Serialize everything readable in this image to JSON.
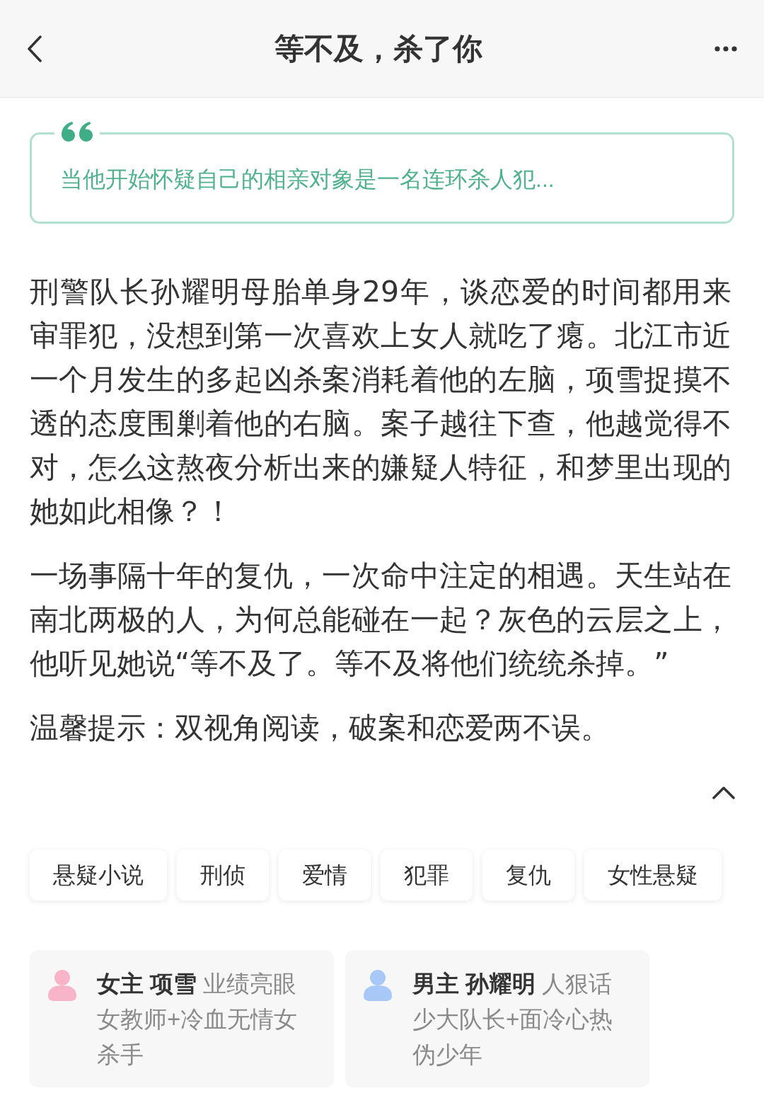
{
  "header": {
    "title": "等不及，杀了你"
  },
  "quote": {
    "text": "当他开始怀疑自己的相亲对象是一名连环杀人犯..."
  },
  "synopsis": {
    "paragraphs": [
      "刑警队长孙耀明母胎单身29年，谈恋爱的时间都用来审罪犯，没想到第一次喜欢上女人就吃了瘪。北江市近一个月发生的多起凶杀案消耗着他的左脑，项雪捉摸不透的态度围剿着他的右脑。案子越往下查，他越觉得不对，怎么这熬夜分析出来的嫌疑人特征，和梦里出现的她如此相像？！",
      "一场事隔十年的复仇，一次命中注定的相遇。天生站在南北两极的人，为何总能碰在一起？灰色的云层之上，他听见她说“等不及了。等不及将他们统统杀掉。”",
      "温馨提示：双视角阅读，破案和恋爱两不误。"
    ],
    "expanded": true
  },
  "tags": [
    "悬疑小说",
    "刑侦",
    "爱情",
    "犯罪",
    "复仇",
    "女性悬疑"
  ],
  "characters": [
    {
      "role": "女主",
      "name": "项雪",
      "description": "业绩亮眼女教师+冷血无情女杀手",
      "color": "#f8b4c8"
    },
    {
      "role": "男主",
      "name": "孙耀明",
      "description": "人狠话少大队长+面冷心热伪少年",
      "color": "#a8c8f8"
    }
  ]
}
